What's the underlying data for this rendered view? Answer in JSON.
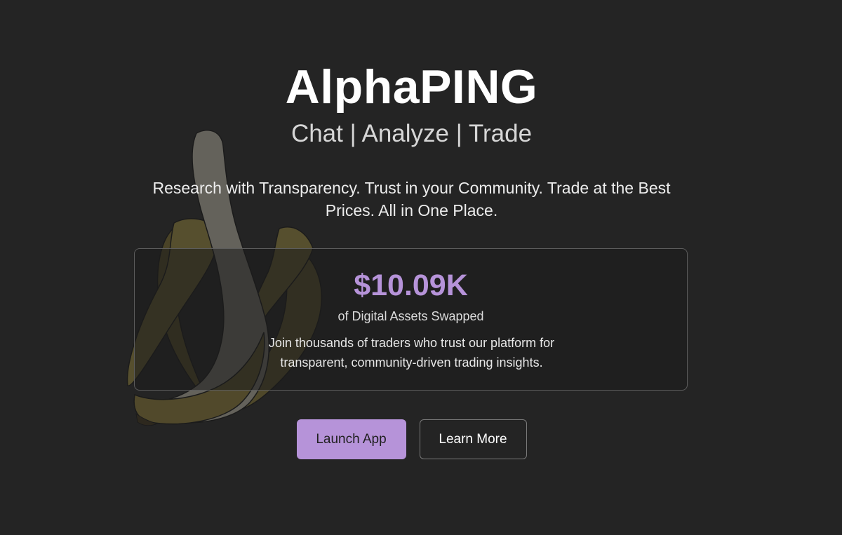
{
  "hero": {
    "title": "AlphaPING",
    "tagline": "Chat | Analyze | Trade",
    "description": "Research with Transparency. Trust in your Community. Trade at the Best Prices. All in One Place.",
    "illustration_icon": "peeled-banana-icon"
  },
  "stats": {
    "value": "$10.09K",
    "label": "of Digital Assets Swapped",
    "note": "Join thousands of traders who trust our platform for transparent, community-driven trading insights."
  },
  "actions": {
    "launch_label": "Launch App",
    "learn_label": "Learn More"
  },
  "colors": {
    "background": "#242424",
    "accent": "#b693d9",
    "text": "#ffffff"
  }
}
